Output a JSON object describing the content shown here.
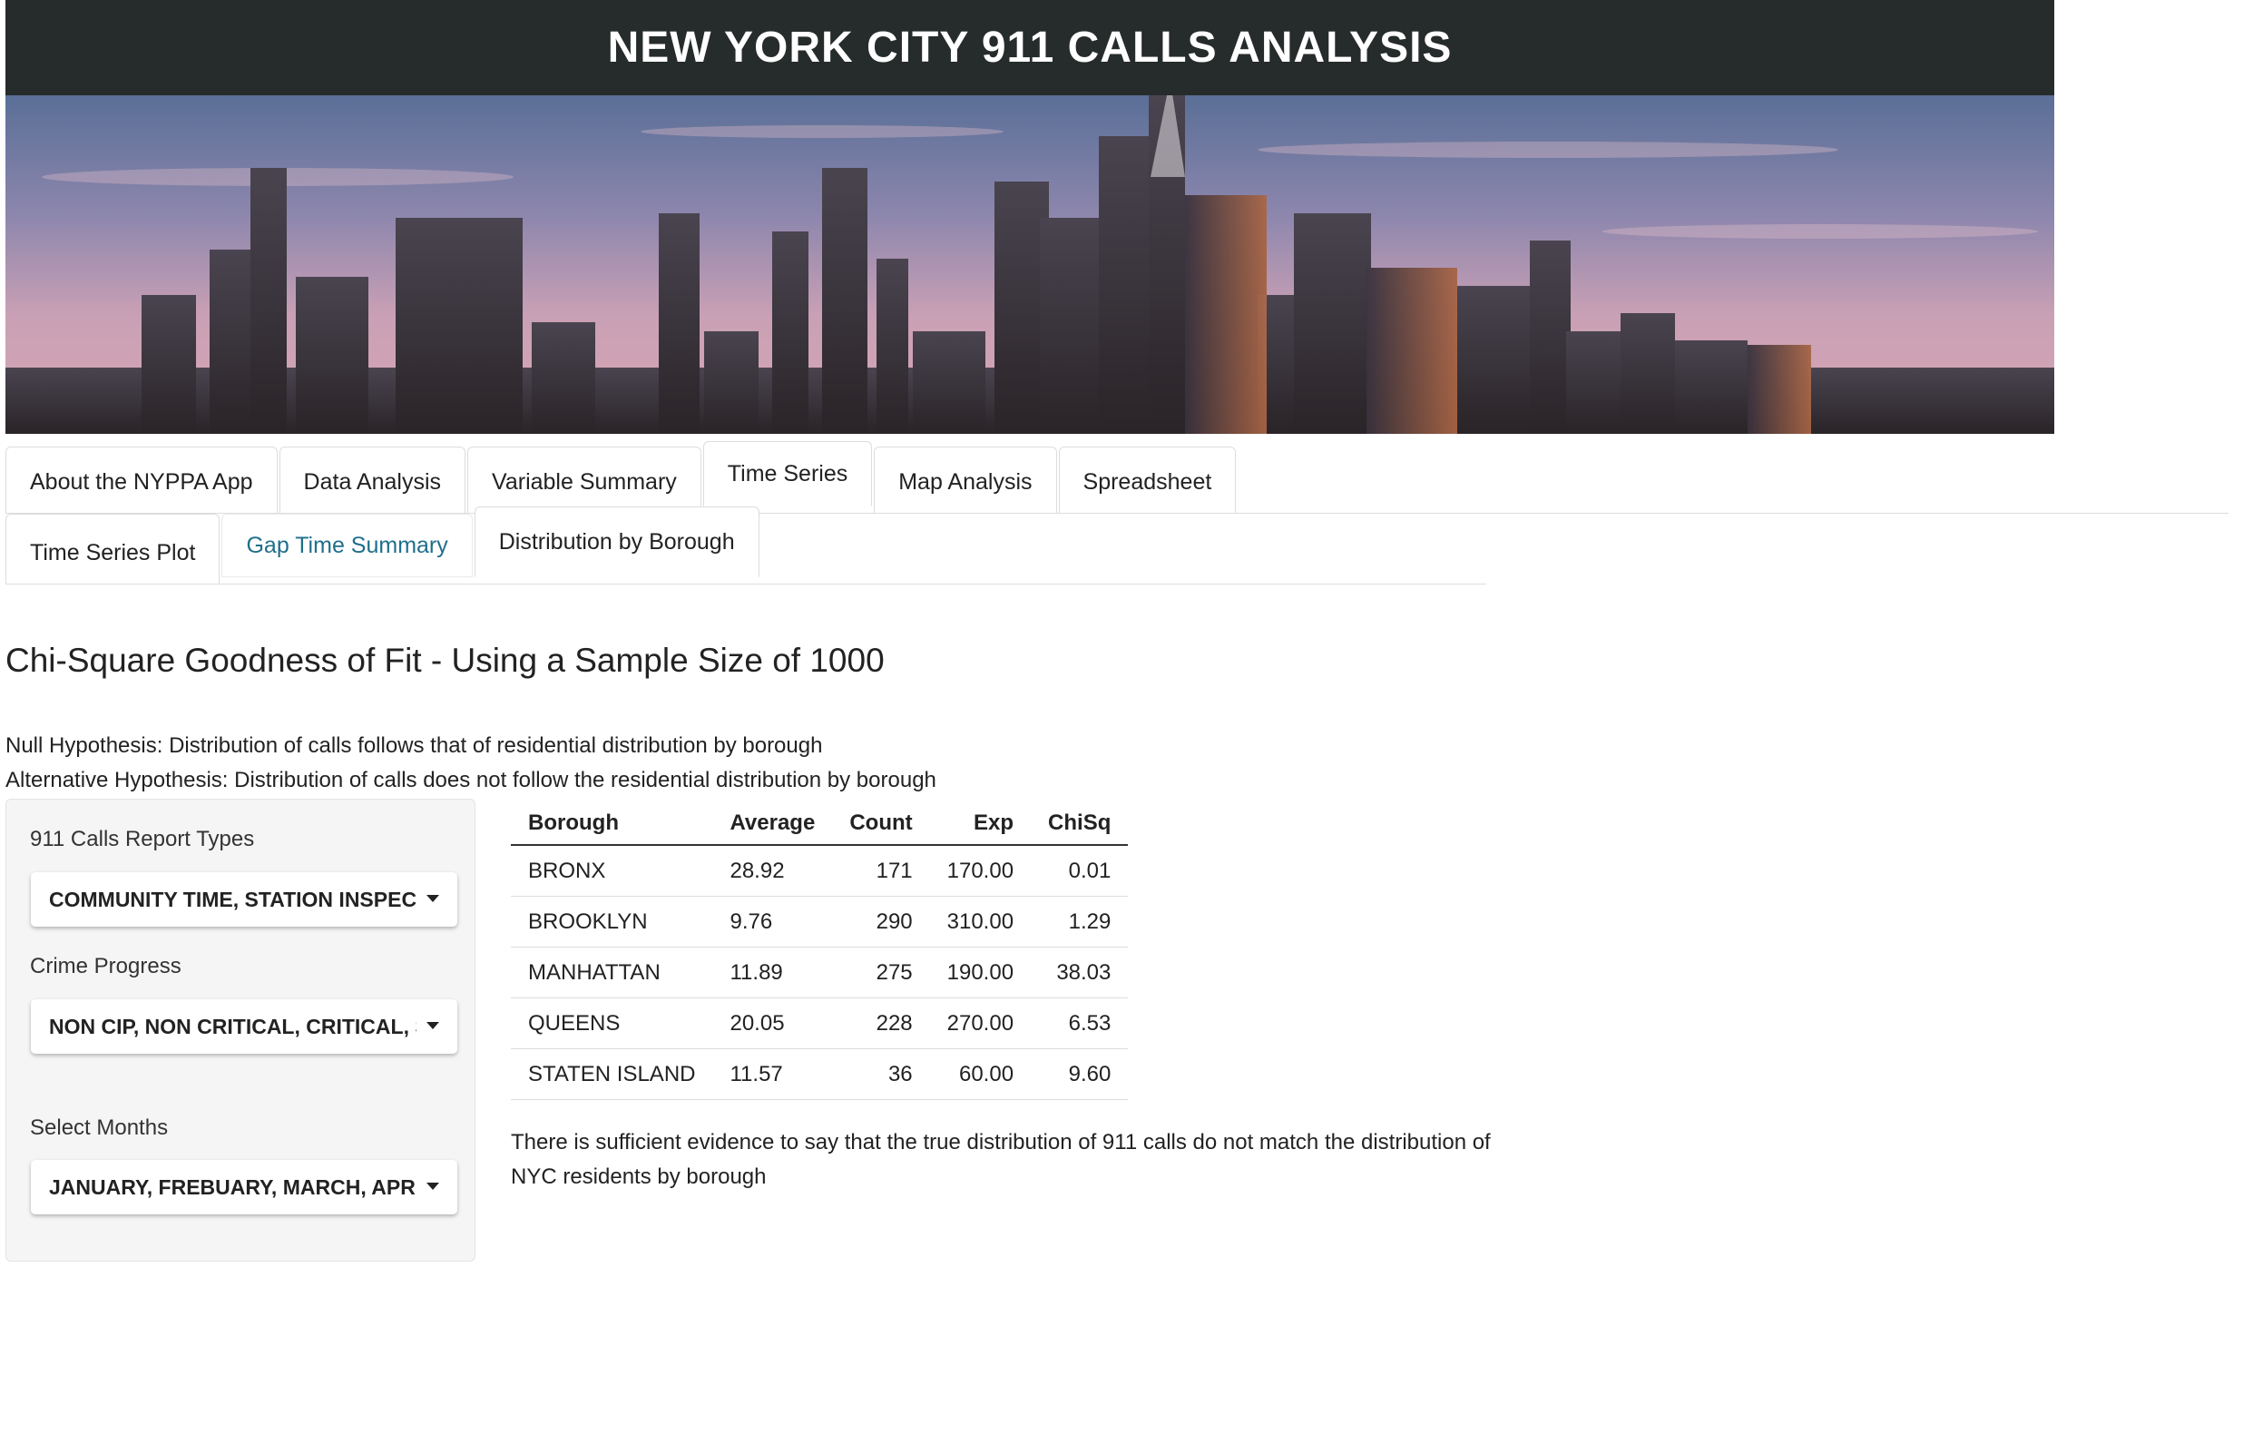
{
  "app": {
    "title": "NEW YORK CITY 911 CALLS ANALYSIS"
  },
  "main_tabs": [
    {
      "label": "About the NYPPA App"
    },
    {
      "label": "Data Analysis"
    },
    {
      "label": "Variable Summary"
    },
    {
      "label": "Time Series",
      "active": true
    },
    {
      "label": "Map Analysis"
    },
    {
      "label": "Spreadsheet"
    }
  ],
  "sub_tabs": [
    {
      "label": "Time Series Plot"
    },
    {
      "label": "Gap Time Summary"
    },
    {
      "label": "Distribution by Borough",
      "active": true
    }
  ],
  "content": {
    "heading": "Chi-Square Goodness of Fit - Using a Sample Size of 1000",
    "null_hypothesis": "Null Hypothesis: Distribution of calls follows that of residential distribution by borough",
    "alt_hypothesis": "Alternative Hypothesis: Distribution of calls does not follow the residential distribution by borough",
    "conclusion": "There is sufficient evidence to say that the true distribution of 911 calls do not match the distribution of NYC residents by borough"
  },
  "sidebar": {
    "report_types": {
      "label": "911 Calls Report Types",
      "value": "COMMUNITY TIME, STATION INSPECTION"
    },
    "crime_progress": {
      "label": "Crime Progress",
      "value": "NON CIP, NON CRITICAL, CRITICAL, SERIOUS"
    },
    "months": {
      "label": "Select Months",
      "value": "JANUARY, FREBUARY, MARCH, APRIL"
    }
  },
  "table": {
    "headers": [
      "Borough",
      "Average",
      "Count",
      "Exp",
      "ChiSq"
    ],
    "rows": [
      [
        "BRONX",
        "28.92",
        "171",
        "170.00",
        "0.01"
      ],
      [
        "BROOKLYN",
        "9.76",
        "290",
        "310.00",
        "1.29"
      ],
      [
        "MANHATTAN",
        "11.89",
        "275",
        "190.00",
        "38.03"
      ],
      [
        "QUEENS",
        "20.05",
        "228",
        "270.00",
        "6.53"
      ],
      [
        "STATEN ISLAND",
        "11.57",
        "36",
        "60.00",
        "9.60"
      ]
    ]
  },
  "colors": {
    "header_bg": "#262c2b",
    "link": "#1f6f8b",
    "panel_bg": "#f5f5f5"
  }
}
